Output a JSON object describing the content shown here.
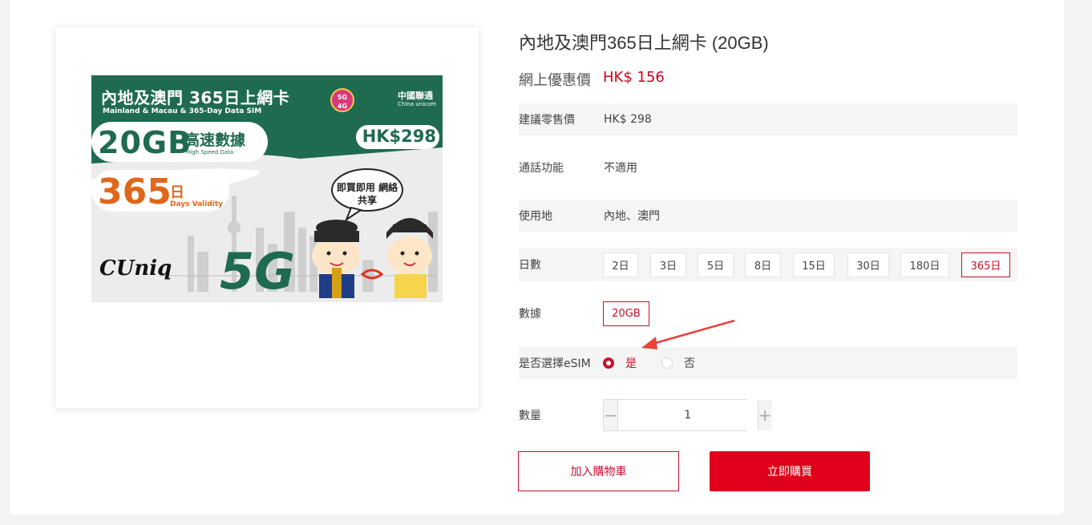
{
  "product": {
    "title": "內地及澳門365日上網卡 (20GB)",
    "price_label": "網上優惠價",
    "price_value": "HK$ 156"
  },
  "image": {
    "title": "內地及澳門 365日上網卡",
    "subtitle": "Mainland & Macau & 365-Day Data SIM",
    "data_amount": "20GB",
    "high_speed": "高速數據",
    "high_speed_en": "High Speed Data",
    "price": "HK$298",
    "days": "365",
    "day_char": "日",
    "days_validity": "Days Validity",
    "network": "5G",
    "brand": "CUniq",
    "bubble": "即買即用 網絡共享",
    "operator": "中國聯通",
    "operator_en": "China unicom",
    "badge": "5G 4G"
  },
  "details": {
    "rrp_label": "建議零售價",
    "rrp_value": "HK$ 298",
    "call_label": "通話功能",
    "call_value": "不適用",
    "region_label": "使用地",
    "region_value": "內地、澳門",
    "days_label": "日數",
    "days_options": [
      "2日",
      "3日",
      "5日",
      "8日",
      "15日",
      "30日",
      "180日",
      "365日"
    ],
    "days_selected": "365日",
    "data_label": "數據",
    "data_options": [
      "20GB"
    ],
    "esim_label": "是否選擇eSIM",
    "esim_yes": "是",
    "esim_no": "否",
    "esim_selected": "是",
    "qty_label": "數量",
    "qty_value": "1"
  },
  "actions": {
    "add_to_cart": "加入購物車",
    "buy_now": "立即購買"
  },
  "colors": {
    "accent": "#c8102e",
    "buy_button": "#e0001b",
    "sim_green": "#1f6b4f",
    "sim_orange": "#e0661a"
  }
}
